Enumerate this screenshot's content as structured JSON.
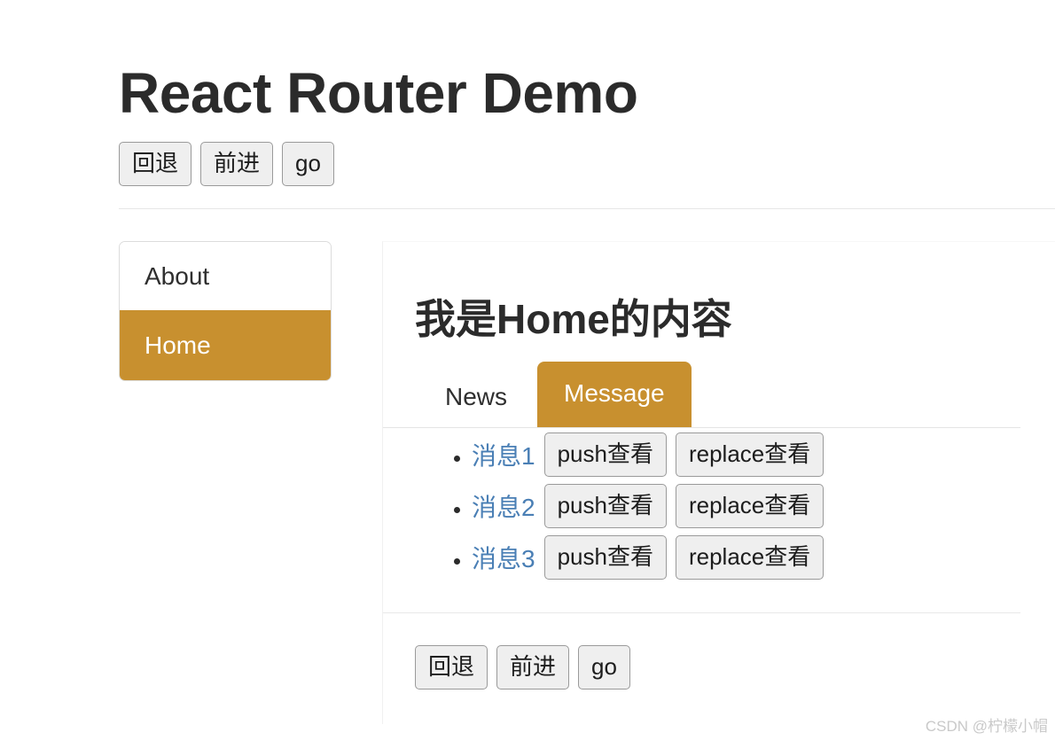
{
  "header": {
    "title": "React Router Demo",
    "nav_buttons": [
      {
        "label": "回退"
      },
      {
        "label": "前进"
      },
      {
        "label": "go"
      }
    ]
  },
  "sidebar": {
    "items": [
      {
        "label": "About",
        "active": false
      },
      {
        "label": "Home",
        "active": true
      }
    ]
  },
  "content": {
    "heading": "我是Home的内容",
    "tabs": [
      {
        "label": "News",
        "active": false
      },
      {
        "label": "Message",
        "active": true
      }
    ],
    "messages": [
      {
        "link": "消息1",
        "push_label": "push查看",
        "replace_label": "replace查看"
      },
      {
        "link": "消息2",
        "push_label": "push查看",
        "replace_label": "replace查看"
      },
      {
        "link": "消息3",
        "push_label": "push查看",
        "replace_label": "replace查看"
      }
    ],
    "nav_buttons": [
      {
        "label": "回退"
      },
      {
        "label": "前进"
      },
      {
        "label": "go"
      }
    ]
  },
  "watermark": "CSDN @柠檬小帽",
  "colors": {
    "accent": "#c8902f",
    "link": "#4a7fb5",
    "text": "#2b2b2b",
    "button_bg": "#efefef",
    "button_border": "#9a9a9a",
    "watermark": "#c9c9c9"
  }
}
